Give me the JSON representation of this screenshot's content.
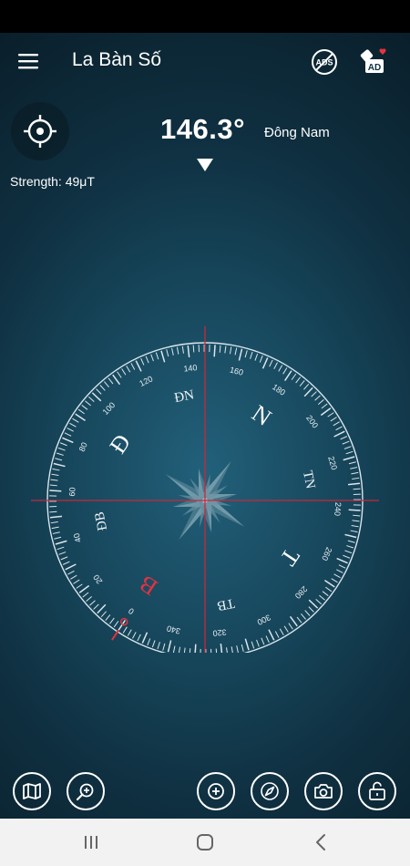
{
  "header": {
    "title": "La Bàn Số",
    "menu_icon": "hamburger-menu-icon",
    "remove_ads_icon": "no-ads-icon",
    "reward_ad_icon": "ad-reward-icon",
    "remove_ads_text": "ADS",
    "reward_ad_text": "AD"
  },
  "readout": {
    "heading": "146.3°",
    "direction": "Đông Nam",
    "strength": "Strength: 49μT"
  },
  "compass": {
    "heading_deg": 146.3,
    "degree_labels": [
      {
        "deg": 0,
        "text": "0"
      },
      {
        "deg": 20,
        "text": "20"
      },
      {
        "deg": 40,
        "text": "40"
      },
      {
        "deg": 60,
        "text": "60"
      },
      {
        "deg": 80,
        "text": "80"
      },
      {
        "deg": 100,
        "text": "100"
      },
      {
        "deg": 120,
        "text": "120"
      },
      {
        "deg": 140,
        "text": "140"
      },
      {
        "deg": 160,
        "text": "160"
      },
      {
        "deg": 180,
        "text": "180"
      },
      {
        "deg": 200,
        "text": "200"
      },
      {
        "deg": 220,
        "text": "220"
      },
      {
        "deg": 240,
        "text": "240"
      },
      {
        "deg": 260,
        "text": "260"
      },
      {
        "deg": 280,
        "text": "280"
      },
      {
        "deg": 300,
        "text": "300"
      },
      {
        "deg": 320,
        "text": "320"
      },
      {
        "deg": 340,
        "text": "340"
      }
    ],
    "cardinals": [
      {
        "deg": 0,
        "text": "B",
        "color": "#e5323f"
      },
      {
        "deg": 90,
        "text": "Đ",
        "color": "#ffffff"
      },
      {
        "deg": 180,
        "text": "N",
        "color": "#ffffff"
      },
      {
        "deg": 270,
        "text": "T",
        "color": "#ffffff"
      }
    ],
    "intercardinals": [
      {
        "deg": 45,
        "text": "ĐB"
      },
      {
        "deg": 135,
        "text": "ĐN"
      },
      {
        "deg": 225,
        "text": "TN"
      },
      {
        "deg": 315,
        "text": "TB"
      }
    ],
    "crosshair_color": "#c8283a",
    "north_color": "#e5323f"
  },
  "bottom": {
    "map_icon": "map-icon",
    "zoom_icon": "zoom-search-icon",
    "add_icon": "add-circle-icon",
    "compass_icon": "compass-icon",
    "camera_icon": "camera-icon",
    "unlock_icon": "lock-open-icon"
  },
  "navbar": {
    "recents_icon": "recents-icon",
    "home_icon": "home-icon",
    "back_icon": "back-icon"
  }
}
